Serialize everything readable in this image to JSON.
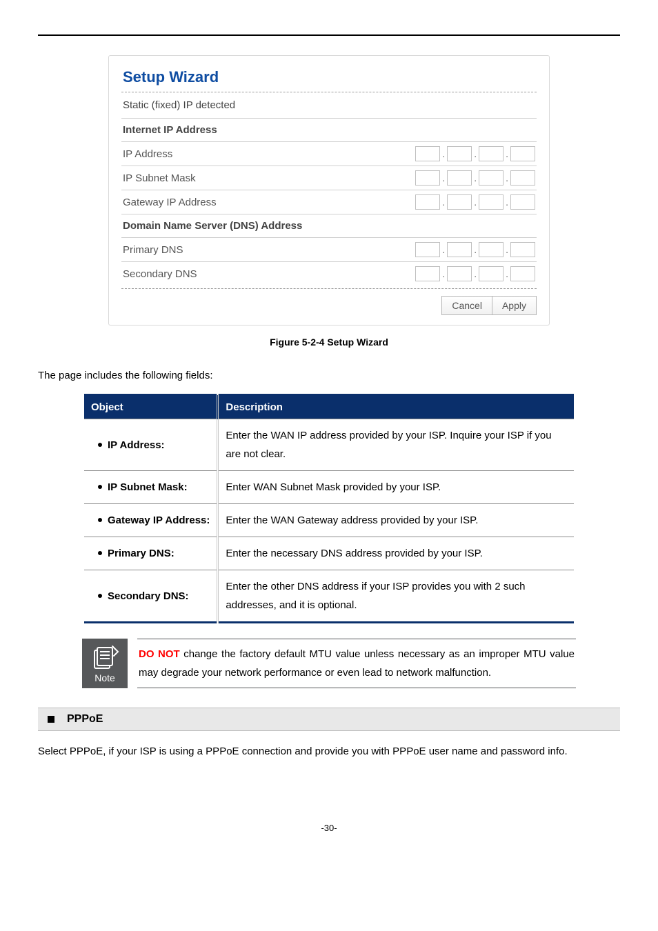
{
  "wizard": {
    "title": "Setup Wizard",
    "subtitle": "Static (fixed) IP detected",
    "sections": {
      "internet": "Internet IP Address",
      "dns": "Domain Name Server (DNS) Address"
    },
    "labels": {
      "ip_address": "IP Address",
      "subnet_mask": "IP Subnet Mask",
      "gateway": "Gateway IP Address",
      "primary_dns": "Primary DNS",
      "secondary_dns": "Secondary DNS"
    },
    "buttons": {
      "cancel": "Cancel",
      "apply": "Apply"
    }
  },
  "figure_caption": "Figure 5-2-4 Setup Wizard",
  "intro_para": "The page includes the following fields:",
  "table": {
    "head_object": "Object",
    "head_description": "Description",
    "rows": [
      {
        "object": "IP Address:",
        "desc": "Enter the WAN IP address provided by your ISP. Inquire your ISP if you are not clear."
      },
      {
        "object": "IP Subnet Mask:",
        "desc": "Enter WAN Subnet Mask provided by your ISP."
      },
      {
        "object": "Gateway IP Address:",
        "desc": "Enter the WAN Gateway address provided by your ISP."
      },
      {
        "object": "Primary DNS:",
        "desc": "Enter the necessary DNS address provided by your ISP."
      },
      {
        "object": "Secondary DNS:",
        "desc": "Enter the other DNS address if your ISP provides you with 2 such addresses, and it is optional."
      }
    ]
  },
  "note": {
    "label": "Note",
    "donot": "DO NOT",
    "text_rest": " change the factory default MTU value unless necessary as an improper MTU value may degrade your network performance or even lead to network malfunction."
  },
  "pppoe": {
    "heading": "PPPoE",
    "body": "Select PPPoE, if your ISP is using a PPPoE connection and provide you with PPPoE user name and password info."
  },
  "page_number": "-30-"
}
